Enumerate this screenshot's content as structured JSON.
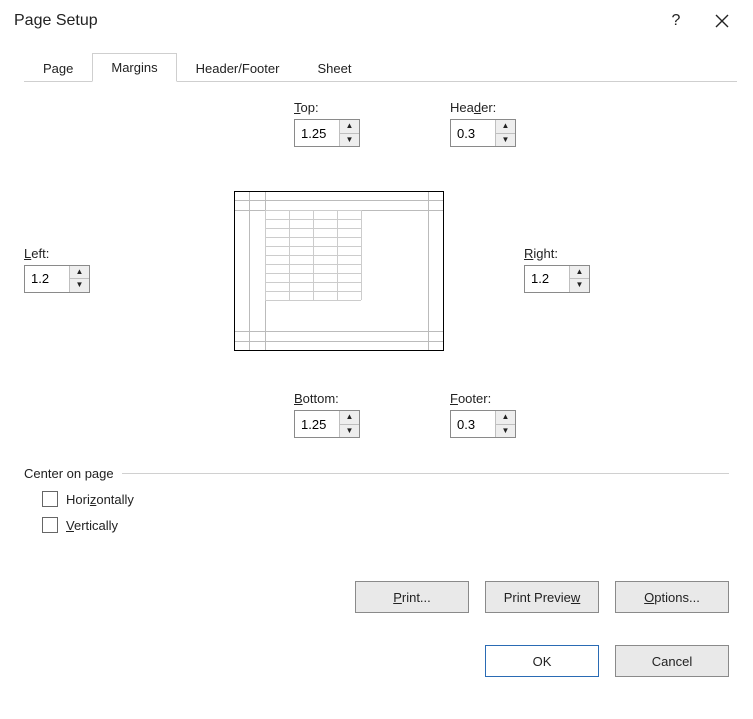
{
  "window": {
    "title": "Page Setup"
  },
  "tabs": {
    "page": "Page",
    "margins": "Margins",
    "headerfooter": "Header/Footer",
    "sheet": "Sheet"
  },
  "labels": {
    "top_pre": "",
    "top_u": "T",
    "top_rest": "op:",
    "header_pre": "Hea",
    "header_u": "d",
    "header_rest": "er:",
    "left_u": "L",
    "left_rest": "eft:",
    "right_u": "R",
    "right_rest": "ight:",
    "bottom_u": "B",
    "bottom_rest": "ottom:",
    "footer_u": "F",
    "footer_rest": "ooter:"
  },
  "values": {
    "top": "1.25",
    "header": "0.3",
    "left": "1.2",
    "right": "1.2",
    "bottom": "1.25",
    "footer": "0.3"
  },
  "center": {
    "legend": "Center on page",
    "horiz_u": "z",
    "horiz_pre": "Hori",
    "horiz_rest": "ontally",
    "vert_u": "V",
    "vert_rest": "ertically"
  },
  "buttons": {
    "print_u": "P",
    "print_rest": "rint...",
    "preview_pre": "Print Previe",
    "preview_u": "w",
    "options_u": "O",
    "options_rest": "ptions...",
    "ok": "OK",
    "cancel": "Cancel"
  }
}
